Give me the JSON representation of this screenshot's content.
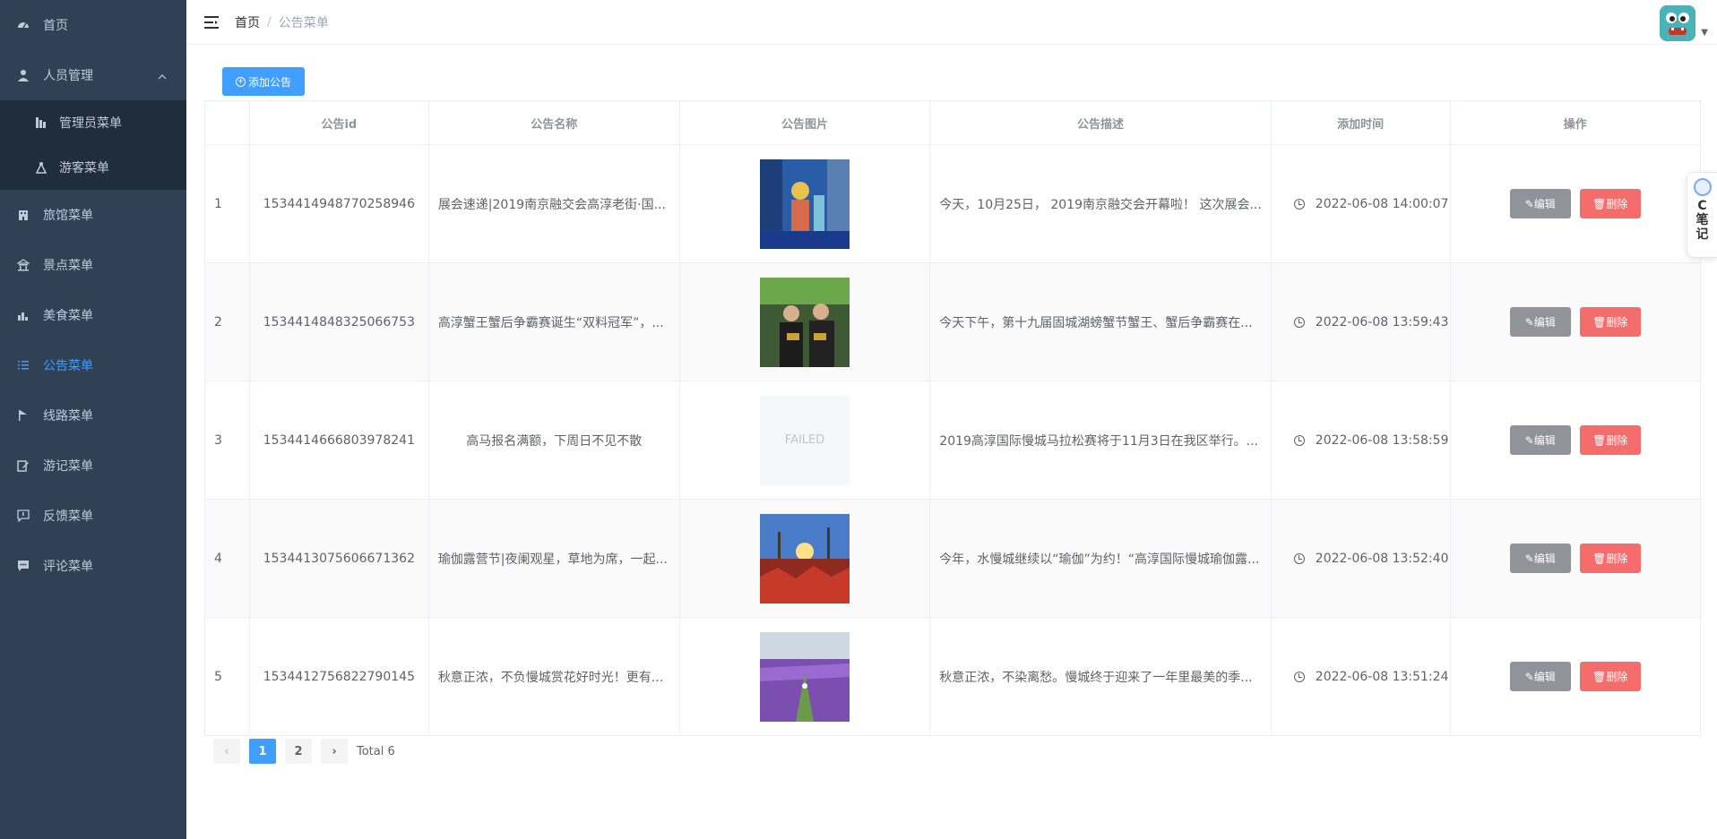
{
  "sidebar": {
    "items": [
      {
        "label": "首页",
        "icon": "dashboard-icon"
      },
      {
        "label": "人员管理",
        "icon": "user-icon"
      },
      {
        "label": "管理员菜单",
        "icon": "chart-icon"
      },
      {
        "label": "游客菜单",
        "icon": "tourist-icon"
      },
      {
        "label": "旅馆菜单",
        "icon": "building-icon"
      },
      {
        "label": "景点菜单",
        "icon": "scenic-icon"
      },
      {
        "label": "美食菜单",
        "icon": "food-icon"
      },
      {
        "label": "公告菜单",
        "icon": "list-icon"
      },
      {
        "label": "线路菜单",
        "icon": "route-icon"
      },
      {
        "label": "游记菜单",
        "icon": "edit-icon"
      },
      {
        "label": "反馈菜单",
        "icon": "feedback-icon"
      },
      {
        "label": "评论菜单",
        "icon": "comment-icon"
      }
    ]
  },
  "navbar": {
    "breadcrumb_home": "首页",
    "breadcrumb_sep": "/",
    "breadcrumb_current": "公告菜单"
  },
  "toolbar": {
    "add_label": "添加公告"
  },
  "table": {
    "headers": [
      "",
      "公告id",
      "公告名称",
      "公告图片",
      "公告描述",
      "添加时间",
      "操作"
    ],
    "rows": [
      {
        "index": "1",
        "id": "1534414948770258946",
        "name": "展会速递|2019南京融交会高淳老街·国...",
        "image": "photo",
        "desc": "今天，10月25日， 2019南京融交会开幕啦！ 这次展会...",
        "time": "2022-06-08 14:00:07"
      },
      {
        "index": "2",
        "id": "1534414848325066753",
        "name": "高淳蟹王蟹后争霸赛诞生“双料冠军”，...",
        "image": "photo",
        "desc": "今天下午，第十九届固城湖螃蟹节蟹王、蟹后争霸赛在...",
        "time": "2022-06-08 13:59:43"
      },
      {
        "index": "3",
        "id": "1534414666803978241",
        "name": "高马报名满额，下周日不见不散",
        "image": "failed",
        "desc": "2019高淳国际慢城马拉松赛将于11月3日在我区举行。...",
        "time": "2022-06-08 13:58:59"
      },
      {
        "index": "4",
        "id": "1534413075606671362",
        "name": "瑜伽露营节|夜阑观星，草地为席，一起...",
        "image": "photo",
        "desc": "今年，水慢城继续以“瑜伽”为约！“高淳国际慢城瑜伽露...",
        "time": "2022-06-08 13:52:40"
      },
      {
        "index": "5",
        "id": "1534412756822790145",
        "name": "秋意正浓，不负慢城赏花好时光！更有...",
        "image": "photo",
        "desc": "秋意正浓，不染离愁。慢城终于迎来了一年里最美的季...",
        "time": "2022-06-08 13:51:24"
      }
    ],
    "edit_label": "编辑",
    "delete_label": "删除",
    "failed_label": "FAILED"
  },
  "pagination": {
    "pages": [
      "1",
      "2"
    ],
    "total": "Total 6"
  },
  "note_tab": {
    "label_c": "C",
    "label_1": "笔",
    "label_2": "记"
  },
  "colors": {
    "sidebar_bg": "#304156",
    "accent": "#409eff",
    "danger": "#f56c6c",
    "info": "#909399"
  }
}
